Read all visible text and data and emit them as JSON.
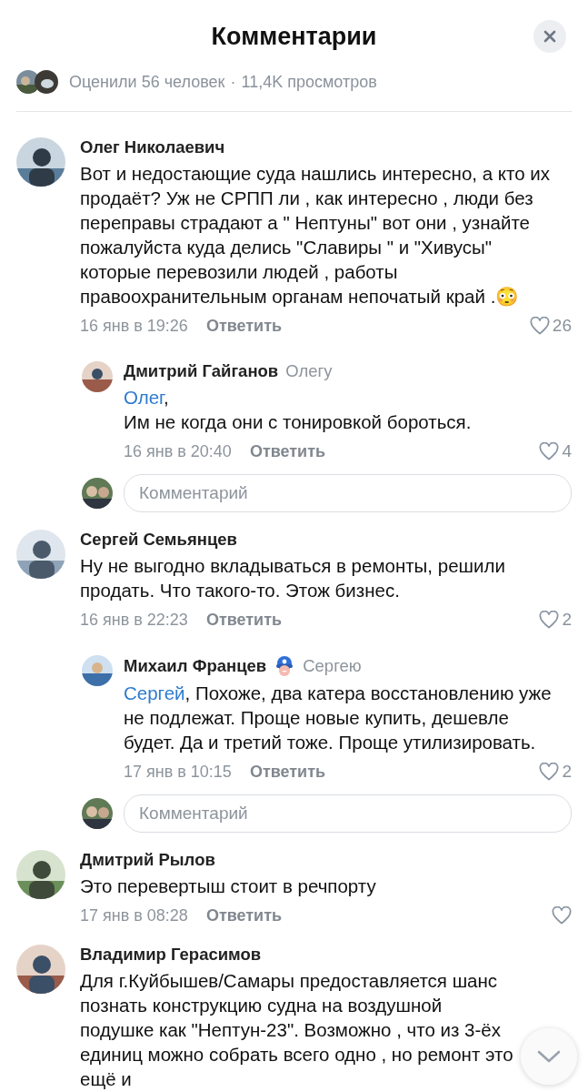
{
  "header": {
    "title": "Комментарии"
  },
  "stats": {
    "rated": "Оценили 56 человек",
    "separator": "·",
    "views": "11,4K просмотров"
  },
  "comments": [
    {
      "author": "Олег Николаевич",
      "text": "Вот и недостающие суда нашлись интересно, а кто их продаёт? Уж не СРПП ли , как интересно , люди без переправы страдают а \" Нептуны\" вот они , узнайте пожалуйста куда делись \"Славиры \" и \"Хивусы\" которые перевозили людей , работы правоохранительным органам непочатый край .😳",
      "time": "16 янв в 19:26",
      "reply": "Ответить",
      "likes": "26",
      "replies": [
        {
          "author": "Дмитрий Гайганов",
          "reply_to": "Олегу",
          "mention": "Олег",
          "text": ",\nИм не когда они с тонировкой бороться.",
          "time": "16 янв в 20:40",
          "reply": "Ответить",
          "likes": "4"
        }
      ],
      "input": {
        "placeholder": "Комментарий"
      }
    },
    {
      "author": "Сергей Семьянцев",
      "text": "Ну не выгодно вкладываться в ремонты, решили продать. Что такого-то. Этож бизнес.",
      "time": "16 янв в 22:23",
      "reply": "Ответить",
      "likes": "2",
      "replies": [
        {
          "author": "Михаил Францев",
          "badge": true,
          "reply_to": "Сергею",
          "mention": "Сергей",
          "text": ", Похоже, два катера восстановлению уже не подлежат. Проще новые купить, дешевле будет. Да и третий тоже. Проще утилизировать.",
          "time": "17 янв в 10:15",
          "reply": "Ответить",
          "likes": "2"
        }
      ],
      "input": {
        "placeholder": "Комментарий"
      }
    },
    {
      "author": "Дмитрий Рылов",
      "text": "Это перевертыш стоит в речпорту",
      "time": "17 янв в 08:28",
      "reply": "Ответить"
    },
    {
      "author": "Владимир Герасимов",
      "text": "Для г.Куйбышев/Самары предоставляется шанс познать конструкцию судна на воздушной подушке как \"Нептун-23\". Возможно , что из 3-ёх единиц можно собрать всего одно , но ремонт это ещё и"
    }
  ]
}
